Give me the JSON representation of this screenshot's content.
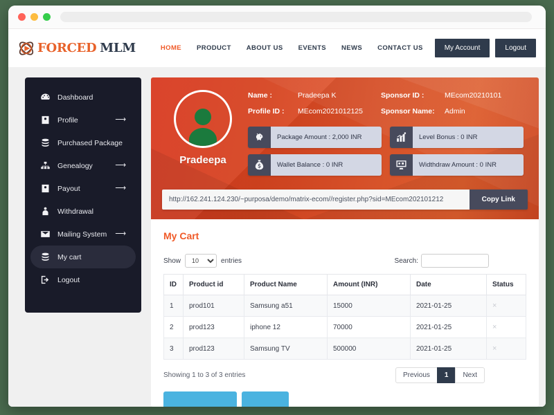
{
  "browser": {
    "url_value": "",
    "dots": [
      "close",
      "minimize",
      "maximize"
    ]
  },
  "header": {
    "logo_part1": "FORCED",
    "logo_part2": "MLM",
    "nav": [
      {
        "label": "HOME",
        "active": true
      },
      {
        "label": "PRODUCT",
        "active": false
      },
      {
        "label": "ABOUT US",
        "active": false
      },
      {
        "label": "EVENTS",
        "active": false
      },
      {
        "label": "NEWS",
        "active": false
      },
      {
        "label": "CONTACT US",
        "active": false
      }
    ],
    "my_account_label": "My Account",
    "logout_label": "Logout"
  },
  "sidebar": {
    "items": [
      {
        "label": "Dashboard",
        "icon": "dashboard-icon",
        "arrow": "",
        "active": false
      },
      {
        "label": "Profile",
        "icon": "user-card-icon",
        "arrow": "⟶",
        "active": false
      },
      {
        "label": "Purchased Package",
        "icon": "stack-icon",
        "arrow": "",
        "active": false
      },
      {
        "label": "Genealogy",
        "icon": "tree-icon",
        "arrow": "⟶",
        "active": false
      },
      {
        "label": "Payout",
        "icon": "user-card-icon",
        "arrow": "⟶",
        "active": false
      },
      {
        "label": "Withdrawal",
        "icon": "withdrawal-icon",
        "arrow": "",
        "active": false
      },
      {
        "label": "Mailing System",
        "icon": "envelope-icon",
        "arrow": "⟶",
        "active": false
      },
      {
        "label": "My cart",
        "icon": "stack-icon",
        "arrow": "",
        "active": true
      },
      {
        "label": "Logout",
        "icon": "logout-icon",
        "arrow": "",
        "active": false
      }
    ]
  },
  "banner": {
    "avatar_name": "Pradeepa",
    "fields": [
      {
        "key": "Name :",
        "value": "Pradeepa K"
      },
      {
        "key": "Sponsor ID :",
        "value": "MEcom20210101"
      },
      {
        "key": "Profile ID :",
        "value": "MEcom2021012125"
      },
      {
        "key": "Sponsor Name:",
        "value": "Admin"
      }
    ],
    "stats": [
      {
        "label": "Package Amount : 2,000 INR",
        "icon": "piggy-bank-icon"
      },
      {
        "label": "Level Bonus : 0 INR",
        "icon": "bar-chart-icon"
      },
      {
        "label": "Wallet Balance : 0 INR",
        "icon": "money-bag-icon"
      },
      {
        "label": "Widthdraw Amount : 0 INR",
        "icon": "monitor-icon"
      }
    ],
    "referral_link": "http://162.241.124.230/~purposa/demo/matrix-ecom//register.php?sid=MEcom202101212",
    "copy_link_label": "Copy Link"
  },
  "cart": {
    "title": "My Cart",
    "show_label": "Show",
    "entries_label": "entries",
    "show_value": "10",
    "show_options": [
      "10",
      "25",
      "50",
      "100"
    ],
    "search_label": "Search:",
    "search_value": "",
    "columns": [
      "ID",
      "Product id",
      "Product Name",
      "Amount (INR)",
      "Date",
      "Status"
    ],
    "rows": [
      {
        "id": "1",
        "product_id": "prod101",
        "product_name": "Samsung a51",
        "amount": "15000",
        "date": "2021-01-25",
        "status": "×"
      },
      {
        "id": "2",
        "product_id": "prod123",
        "product_name": "iphone 12",
        "amount": "70000",
        "date": "2021-01-25",
        "status": "×"
      },
      {
        "id": "3",
        "product_id": "prod123",
        "product_name": "Samsung TV",
        "amount": "500000",
        "date": "2021-01-25",
        "status": "×"
      }
    ],
    "showing_text": "Showing 1 to 3 of 3 entries",
    "pager": {
      "previous": "Previous",
      "page": "1",
      "next": "Next"
    },
    "bottom_buttons": [
      "",
      ""
    ]
  },
  "colors": {
    "accent_orange": "#f05a28",
    "banner_red": "#d8381f",
    "dark_navy": "#2f3b4c",
    "sidebar_bg": "#191b29",
    "stat_panel": "#d3d7e4",
    "button_blue": "#4ab3e0",
    "page_bg": "#4a6b4f"
  }
}
